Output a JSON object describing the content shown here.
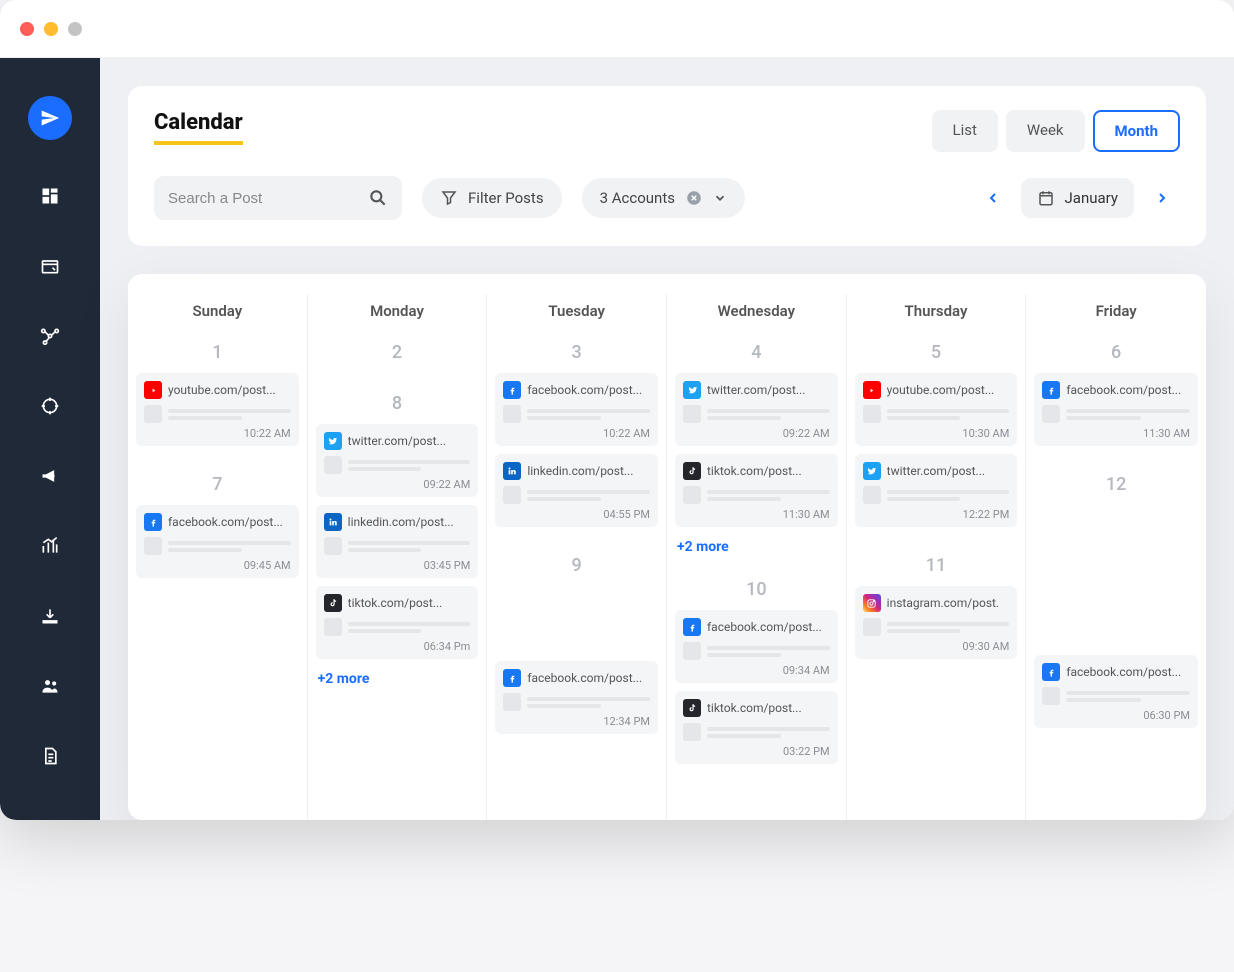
{
  "page": {
    "title": "Calendar"
  },
  "viewTabs": {
    "list": "List",
    "week": "Week",
    "month": "Month",
    "active": "month"
  },
  "search": {
    "placeholder": "Search a Post"
  },
  "filter": {
    "label": "Filter Posts"
  },
  "accounts": {
    "label": "3 Accounts"
  },
  "monthNav": {
    "current": "January"
  },
  "days": {
    "0": "Sunday",
    "1": "Monday",
    "2": "Tuesday",
    "3": "Wednesday",
    "4": "Thursday",
    "5": "Friday"
  },
  "week1": {
    "dates": {
      "0": "1",
      "1": "2",
      "2": "3",
      "3": "4",
      "4": "5",
      "5": "6"
    },
    "events": {
      "0": [
        {
          "platform": "youtube",
          "title": "youtube.com/post...",
          "time": "10:22 AM"
        }
      ],
      "1": [],
      "2": [
        {
          "platform": "facebook",
          "title": "facebook.com/post...",
          "time": "10:22 AM"
        },
        {
          "platform": "linkedin",
          "title": "linkedin.com/post...",
          "time": "04:55 PM"
        }
      ],
      "3": [
        {
          "platform": "twitter",
          "title": "twitter.com/post...",
          "time": "09:22 AM"
        },
        {
          "platform": "tiktok",
          "title": "tiktok.com/post...",
          "time": "11:30 AM"
        }
      ],
      "4": [
        {
          "platform": "youtube",
          "title": "youtube.com/post...",
          "time": "10:30 AM"
        },
        {
          "platform": "twitter",
          "title": "twitter.com/post...",
          "time": "12:22 PM"
        }
      ],
      "5": [
        {
          "platform": "facebook",
          "title": "facebook.com/post...",
          "time": "11:30 AM"
        }
      ]
    },
    "more": {
      "3": "+2 more"
    }
  },
  "week2": {
    "dates": {
      "0": "7",
      "1": "8",
      "2": "9",
      "3": "10",
      "4": "11",
      "5": "12"
    },
    "events": {
      "0": [
        {
          "platform": "facebook",
          "title": "facebook.com/post...",
          "time": "09:45 AM"
        }
      ],
      "1": [
        {
          "platform": "twitter",
          "title": "twitter.com/post...",
          "time": "09:22 AM"
        },
        {
          "platform": "linkedin",
          "title": "linkedin.com/post...",
          "time": "03:45 PM"
        },
        {
          "platform": "tiktok",
          "title": "tiktok.com/post...",
          "time": "06:34 Pm"
        }
      ],
      "2": [
        {
          "platform": "facebook",
          "title": "facebook.com/post...",
          "time": "12:34 PM"
        }
      ],
      "3": [
        {
          "platform": "facebook",
          "title": "facebook.com/post...",
          "time": "09:34 AM"
        },
        {
          "platform": "tiktok",
          "title": "tiktok.com/post...",
          "time": "03:22 PM"
        }
      ],
      "4": [
        {
          "platform": "instagram",
          "title": "instagram.com/post.",
          "time": "09:30 AM"
        }
      ],
      "5": [
        {
          "platform": "facebook",
          "title": "facebook.com/post...",
          "time": "06:30 PM"
        }
      ]
    },
    "more": {
      "1": "+2 more"
    },
    "spacer": {
      "2": 1,
      "5": 2
    }
  }
}
